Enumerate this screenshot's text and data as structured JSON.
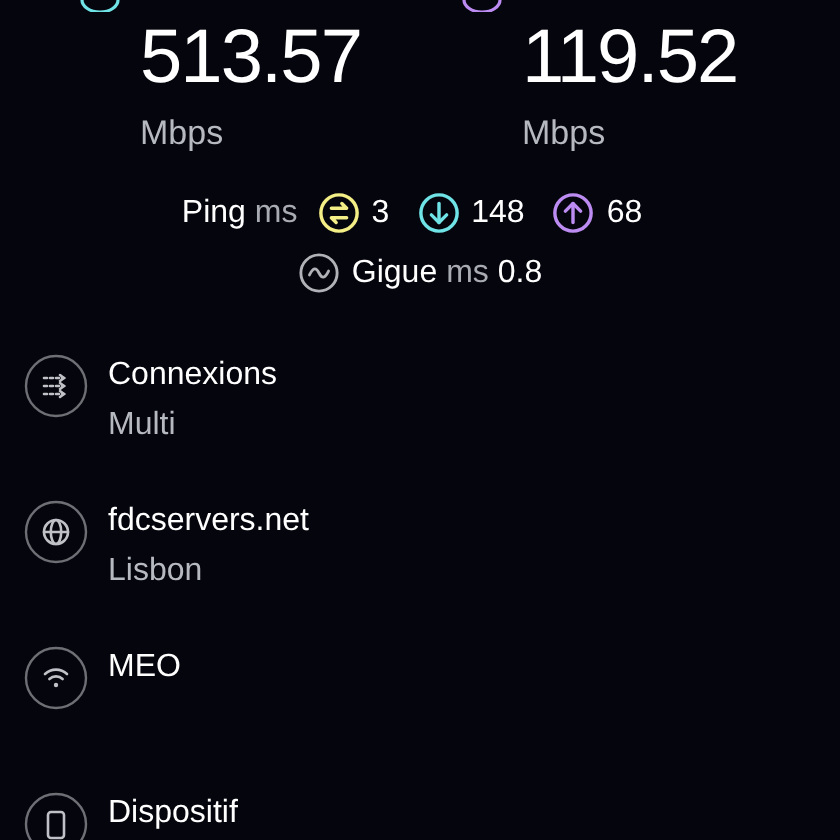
{
  "results": [
    {
      "kind": "download",
      "value": "513.57",
      "unit": "Mbps"
    },
    {
      "kind": "upload",
      "value": "119.52",
      "unit": "Mbps"
    }
  ],
  "ping": {
    "label": "Ping",
    "unit": "ms",
    "readings": [
      {
        "kind": "idle",
        "value": "3"
      },
      {
        "kind": "download",
        "value": "148"
      },
      {
        "kind": "upload",
        "value": "68"
      }
    ]
  },
  "jitter": {
    "label": "Gigue",
    "unit": "ms",
    "value": "0.8"
  },
  "details": [
    {
      "kind": "connections",
      "title": "Connexions",
      "subtitle": "Multi"
    },
    {
      "kind": "server",
      "title": "fdcservers.net",
      "subtitle": "Lisbon"
    },
    {
      "kind": "provider",
      "title": "MEO"
    },
    {
      "kind": "device",
      "title": "Dispositif"
    }
  ]
}
